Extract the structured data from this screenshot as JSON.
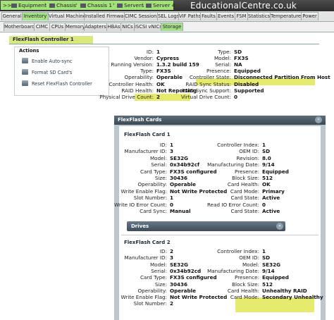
{
  "breadcrumb": {
    "prefix": ">>",
    "items": [
      "Equipment",
      "Chassis",
      "Chassis 1",
      "Servers",
      "Server 4"
    ]
  },
  "watermark": "EducationalCentre.co.uk",
  "main_tabs": [
    "General",
    "Inventory",
    "Virtual Machines",
    "Installed Firmware",
    "CIMC Sessions",
    "SEL Logs",
    "VIF Paths",
    "Faults",
    "Events",
    "FSM",
    "Statistics",
    "Temperatures",
    "Power"
  ],
  "sub_tabs": [
    "Motherboard",
    "CIMC",
    "CPUs",
    "Memory",
    "Adapters",
    "HBAs",
    "NICs",
    "iSCSI vNICs",
    "Storage"
  ],
  "controller_title": "FlexFlash Controller 1",
  "actions": {
    "heading": "Actions",
    "items": [
      "Enable Auto-sync",
      "Format SD Card's",
      "Reset FlexFlash Controller"
    ]
  },
  "controller_left": [
    {
      "label": "ID:",
      "value": "1"
    },
    {
      "label": "Vendor:",
      "value": "Cypress"
    },
    {
      "label": "Running Version:",
      "value": "1.3.2 build 159"
    },
    {
      "label": "Type:",
      "value": "FX3S"
    },
    {
      "label": "Operability:",
      "value": "Operable"
    },
    {
      "label": "Controller Health:",
      "value": "OK"
    },
    {
      "label": "RAID Health:",
      "value": "Not Reporting"
    },
    {
      "label": "Physical Drive Count:",
      "value": "2"
    }
  ],
  "controller_right": [
    {
      "label": "Type:",
      "value": "SD"
    },
    {
      "label": "Model:",
      "value": "FX3S"
    },
    {
      "label": "Serial:",
      "value": "NA"
    },
    {
      "label": "Presence:",
      "value": "Equipped"
    },
    {
      "label": "Controller State:",
      "value": "Disconnected Partition From Host"
    },
    {
      "label": "RAID Sync Status:",
      "value": "Disabled"
    },
    {
      "label": "RAID Sync Support:",
      "value": "Supported"
    },
    {
      "label": "Virtual Drive Count:",
      "value": "0"
    }
  ],
  "cards_title": "FlexFlash Cards",
  "collapse_glyph": "«",
  "card1": {
    "title": "FlexFlash Card 1",
    "left": [
      {
        "label": "ID:",
        "value": "1"
      },
      {
        "label": "Manufacturer ID:",
        "value": "3"
      },
      {
        "label": "Model:",
        "value": "SE32G"
      },
      {
        "label": "Serial:",
        "value": "0x34b92cf"
      },
      {
        "label": "Card Type:",
        "value": "FX3S configured"
      },
      {
        "label": "Size:",
        "value": "30436"
      },
      {
        "label": "Operability:",
        "value": "Operable"
      },
      {
        "label": "Write Enable Flag:",
        "value": "Not Write Protected"
      },
      {
        "label": "Slot Number:",
        "value": "1"
      },
      {
        "label": "Write IO Error Count:",
        "value": "0"
      },
      {
        "label": "Card Sync:",
        "value": "Manual"
      }
    ],
    "right": [
      {
        "label": "Controller Index:",
        "value": "1"
      },
      {
        "label": "OEM ID:",
        "value": "SD"
      },
      {
        "label": "Revision:",
        "value": "8.0"
      },
      {
        "label": "Manufacturing Date:",
        "value": "9/14"
      },
      {
        "label": "Presence:",
        "value": "Equipped"
      },
      {
        "label": "Block Size:",
        "value": "512"
      },
      {
        "label": "Card Health:",
        "value": "OK"
      },
      {
        "label": "Card Mode:",
        "value": "Primary"
      },
      {
        "label": "Card State:",
        "value": "Active"
      },
      {
        "label": "Read IO Error Count:",
        "value": "0"
      },
      {
        "label": "Card State:",
        "value": "Active"
      }
    ]
  },
  "drives_title": "Drives",
  "card2": {
    "title": "FlexFlash Card 2",
    "left": [
      {
        "label": "ID:",
        "value": "2"
      },
      {
        "label": "Manufacturer ID:",
        "value": "3"
      },
      {
        "label": "Model:",
        "value": "SE32G"
      },
      {
        "label": "Serial:",
        "value": "0x34b92cd"
      },
      {
        "label": "Card Type:",
        "value": "FX3S configured"
      },
      {
        "label": "Size:",
        "value": "30436"
      },
      {
        "label": "Operability:",
        "value": "Operable"
      },
      {
        "label": "Write Enable Flag:",
        "value": "Not Write Protected"
      },
      {
        "label": "Slot Number:",
        "value": "2"
      }
    ],
    "right": [
      {
        "label": "Controller Index:",
        "value": "1"
      },
      {
        "label": "OEM ID:",
        "value": "SD"
      },
      {
        "label": "Model:",
        "value": "SE32G"
      },
      {
        "label": "Manufacturing Date:",
        "value": "9/14"
      },
      {
        "label": "Presence:",
        "value": "Equipped"
      },
      {
        "label": "Block Size:",
        "value": "512"
      },
      {
        "label": "Card Health:",
        "value": "Unhealthy RAID"
      },
      {
        "label": "Card Mode:",
        "value": "Secondary Unhealthy"
      }
    ]
  },
  "colors": {
    "highlight": "#e6eb6d",
    "active_tab": "#a6e08a",
    "panel_header": "#3b4956"
  }
}
